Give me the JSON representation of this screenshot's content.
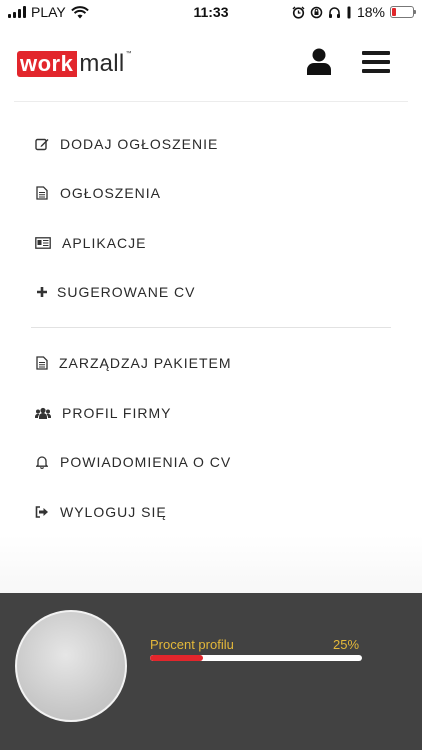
{
  "status_bar": {
    "carrier": "PLAY",
    "time": "11:33",
    "battery": "18%",
    "battery_level": 0.18
  },
  "header": {
    "logo_part1": "work",
    "logo_part2": "mall",
    "logo_tm": "™"
  },
  "menu": {
    "items": [
      {
        "label": "DODAJ OGŁOSZENIE",
        "icon": "edit-icon"
      },
      {
        "label": "OGŁOSZENIA",
        "icon": "document-icon"
      },
      {
        "label": "APLIKACJE",
        "icon": "id-card-icon"
      },
      {
        "label": "SUGEROWANE CV",
        "icon": "plus-icon"
      },
      {
        "label": "ZARZĄDZAJ PAKIETEM",
        "icon": "document-icon"
      },
      {
        "label": "PROFIL FIRMY",
        "icon": "users-icon"
      },
      {
        "label": "POWIADOMIENIA O CV",
        "icon": "bell-icon"
      },
      {
        "label": "WYLOGUJ SIĘ",
        "icon": "sign-out-icon"
      }
    ]
  },
  "profile": {
    "progress_label": "Procent profilu",
    "progress_value": "25%",
    "progress_fraction": 0.25
  },
  "colors": {
    "brand_red": "#e2262c",
    "panel_bg": "#424242",
    "progress_label": "#e3b83a"
  }
}
